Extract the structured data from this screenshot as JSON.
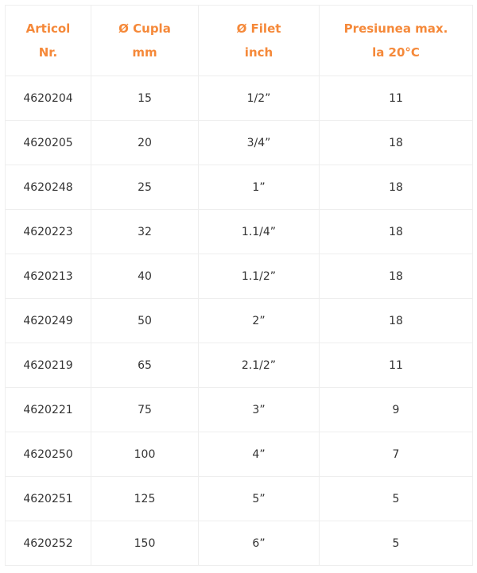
{
  "table": {
    "headers": [
      {
        "line1": "Articol",
        "line2": "Nr."
      },
      {
        "line1": "Ø Cupla",
        "line2": "mm"
      },
      {
        "line1": "Ø Filet",
        "line2": "inch"
      },
      {
        "line1": "Presiunea max.",
        "line2": "la 20°C"
      }
    ],
    "rows": [
      {
        "articol": "4620204",
        "cupla": "15",
        "filet": "1/2”",
        "presiune": "11"
      },
      {
        "articol": "4620205",
        "cupla": "20",
        "filet": "3/4”",
        "presiune": "18"
      },
      {
        "articol": "4620248",
        "cupla": "25",
        "filet": "1”",
        "presiune": "18"
      },
      {
        "articol": "4620223",
        "cupla": "32",
        "filet": "1.1/4”",
        "presiune": "18"
      },
      {
        "articol": "4620213",
        "cupla": "40",
        "filet": "1.1/2”",
        "presiune": "18"
      },
      {
        "articol": "4620249",
        "cupla": "50",
        "filet": "2”",
        "presiune": "18"
      },
      {
        "articol": "4620219",
        "cupla": "65",
        "filet": "2.1/2”",
        "presiune": "11"
      },
      {
        "articol": "4620221",
        "cupla": "75",
        "filet": "3”",
        "presiune": "9"
      },
      {
        "articol": "4620250",
        "cupla": "100",
        "filet": "4”",
        "presiune": "7"
      },
      {
        "articol": "4620251",
        "cupla": "125",
        "filet": "5”",
        "presiune": "5"
      },
      {
        "articol": "4620252",
        "cupla": "150",
        "filet": "6”",
        "presiune": "5"
      }
    ]
  },
  "colors": {
    "header_text": "#f5893a",
    "body_text": "#333333",
    "border": "#eeeeee"
  }
}
